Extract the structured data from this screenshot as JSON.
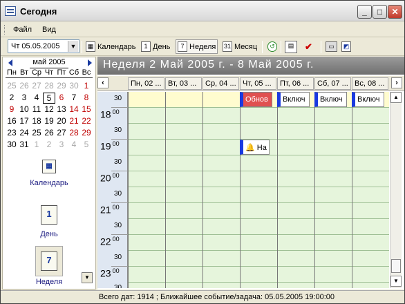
{
  "window": {
    "title": "Сегодня"
  },
  "menu": [
    "Файл",
    "Вид"
  ],
  "toolbar": {
    "date_value": "Чт 05.05.2005",
    "calendar": "Календарь",
    "day": "День",
    "week": "Неделя",
    "month": "Месяц"
  },
  "mini_calendar": {
    "month": "май 2005",
    "weekdays": [
      "Пн",
      "Вт",
      "Ср",
      "Чт",
      "Пт",
      "Сб",
      "Вс"
    ],
    "weeks": [
      [
        "25",
        "26",
        "27",
        "28",
        "29",
        "30",
        "1"
      ],
      [
        "2",
        "3",
        "4",
        "5",
        "6",
        "7",
        "8"
      ],
      [
        "9",
        "10",
        "11",
        "12",
        "13",
        "14",
        "15"
      ],
      [
        "16",
        "17",
        "18",
        "19",
        "20",
        "21",
        "22"
      ],
      [
        "23",
        "24",
        "25",
        "26",
        "27",
        "28",
        "29"
      ],
      [
        "30",
        "31",
        "1",
        "2",
        "3",
        "4",
        "5"
      ]
    ]
  },
  "nav": {
    "calendar": "Календарь",
    "day": "День",
    "week": "Неделя",
    "day_icon": "1",
    "week_icon": "7"
  },
  "week_title": "Неделя   2 Май 2005 г. - 8 Май 2005 г.",
  "days": [
    "Пн, 02 ...",
    "Вт, 03 ...",
    "Ср, 04 ...",
    "Чт, 05 ...",
    "Пт, 06 ...",
    "Сб, 07 ...",
    "Вс, 08 ..."
  ],
  "times": {
    "half": "30",
    "zero": "00",
    "hours": [
      "18",
      "19",
      "20",
      "21",
      "22",
      "23"
    ]
  },
  "events": {
    "thu": "Обнов",
    "fri": "Включ",
    "sat": "Включ",
    "sun": "Включ",
    "thu19": "На"
  },
  "status": "Всего дат: 1914 ; Ближайшее событие/задача: 05.05.2005 19:00:00"
}
